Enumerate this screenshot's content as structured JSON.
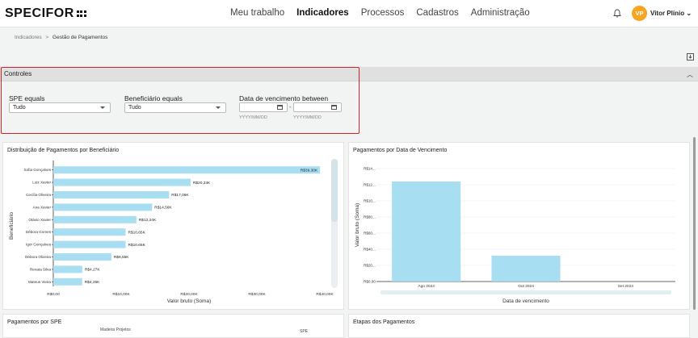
{
  "header": {
    "logo": "SPECIFOR",
    "nav": [
      "Meu trabalho",
      "Indicadores",
      "Processos",
      "Cadastros",
      "Administração"
    ],
    "active_nav": "Indicadores",
    "avatar_initials": "VP",
    "user_name": "Vitor Plínio"
  },
  "breadcrumb": {
    "parent": "Indicadores",
    "separator": ">",
    "current": "Gestão de Pagamentos"
  },
  "controls": {
    "title": "Controles",
    "spe": {
      "label": "SPE equals",
      "value": "Tudo"
    },
    "beneficiario": {
      "label": "Beneficiário equals",
      "value": "Tudo"
    },
    "vencimento": {
      "label": "Data de vencimento between",
      "start_hint": "YYYY/MM/DD",
      "end_hint": "YYYY/MM/DD",
      "separator": "-"
    }
  },
  "panels": {
    "beneficiario_title": "Distribuição de Pagamentos por Beneficiário",
    "vencimento_title": "Pagamentos por Data de Vencimento",
    "spe_title": "Pagamentos por SPE",
    "spe_partial_label": "Madeira Projetos",
    "spe_partial_label_right": "SPE",
    "etapas_title": "Etapas dos Pagamentos"
  },
  "chart_data": [
    {
      "type": "bar",
      "orientation": "horizontal",
      "title": "Distribuição de Pagamentos por Beneficiário",
      "xlabel": "Valor bruto (Soma)",
      "ylabel": "Beneficiário",
      "categories": [
        "Sofia Gonçalves",
        "Luiz Xavier",
        "Cecília Oliveira",
        "Ana Xavier",
        "Otávio Xavier",
        "Débora Gomes",
        "Igor Gonçalves",
        "Débora Oliveira",
        "Renata Silva",
        "Mateus Vieira"
      ],
      "values": [
        39300,
        20230,
        17060,
        14560,
        12240,
        10650,
        10650,
        8550,
        4270,
        4250
      ],
      "data_labels": [
        "R$39,30K",
        "R$20,23K",
        "R$17,06K",
        "R$14,56K",
        "R$12,24K",
        "R$10,65K",
        "R$10,65K",
        "R$8,55K",
        "R$4,27K",
        "R$4,25K"
      ],
      "xlim": [
        0,
        40000
      ],
      "xticks": [
        "R$0,00",
        "R$10,00K",
        "R$20,00K",
        "R$30,00K",
        "R$40,00K"
      ],
      "bar_color": "#a7def2"
    },
    {
      "type": "bar",
      "title": "Pagamentos por Data de Vencimento",
      "xlabel": "Data de vencimento",
      "ylabel": "Valor bruto (Soma)",
      "categories": [
        "Ago 2024",
        "Out 2024",
        "Set 2024"
      ],
      "values": [
        124000,
        32000,
        0
      ],
      "ylim": [
        0,
        140000
      ],
      "yticks": [
        "R$0,00",
        "R$20...",
        "R$40...",
        "R$60...",
        "R$80...",
        "R$10...",
        "R$12...",
        "R$14..."
      ],
      "bar_color": "#a7def2"
    }
  ]
}
